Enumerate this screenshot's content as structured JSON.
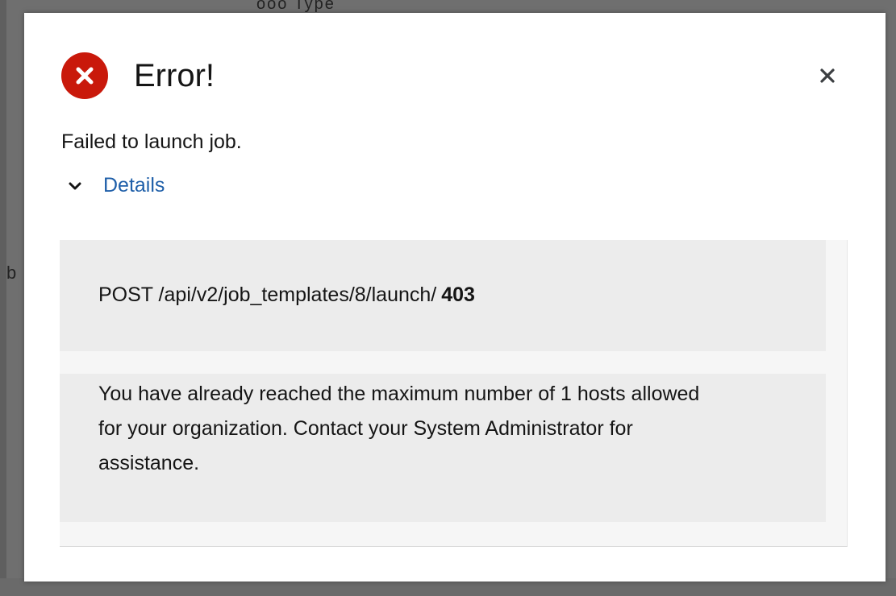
{
  "dialog": {
    "title": "Error!",
    "message": "Failed to launch job.",
    "details_toggle_label": "Details",
    "close_label": "Close",
    "details": {
      "request_line": "POST /api/v2/job_templates/8/launch/",
      "status_code": "403",
      "response_message": "You have already reached the maximum number of 1 hosts allowed for your organization. Contact your System Administrator for assistance."
    }
  },
  "background": {
    "peek_left_text": "b",
    "peek_top_text": "ooo Type"
  },
  "colors": {
    "error": "#c9190b",
    "link": "#1f5fa9",
    "overlay": "#6f6f6f"
  },
  "icons": {
    "status": "error-circle-icon",
    "close": "close-icon",
    "toggle": "chevron-down-icon"
  }
}
